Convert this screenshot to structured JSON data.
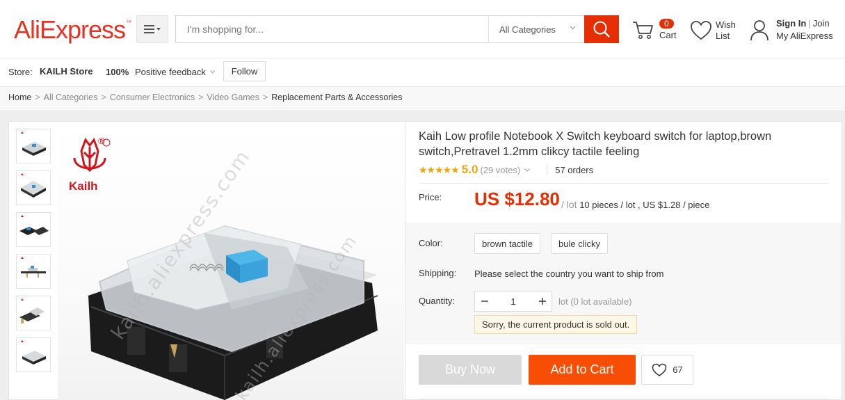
{
  "header": {
    "logo": "AliExpress",
    "logo_tm": "™",
    "search_placeholder": "I'm shopping for...",
    "category": "All Categories",
    "cart_count": "0",
    "cart_label": "Cart",
    "wish_label": "Wish List",
    "sign_in": "Sign In",
    "join": "Join",
    "my_account": "My AliExpress"
  },
  "store": {
    "label": "Store:",
    "name": "KAILH Store",
    "positive_pct": "100%",
    "positive_label": "Positive feedback",
    "follow_label": "Follow"
  },
  "breadcrumb": {
    "home": "Home",
    "items": [
      "All Categories",
      "Consumer Electronics",
      "Video Games"
    ],
    "current": "Replacement Parts & Accessories"
  },
  "gallery": {
    "brand_text": "Kailh",
    "registered": "®",
    "watermark": "kailh.aliexpress.com",
    "thumb_count": 6
  },
  "product": {
    "title": "Kaih Low profile Notebook X Switch keyboard switch for laptop,brown switch,Pretravel 1.2mm clikcy tactile feeling",
    "stars": "★★★★★",
    "rating": "5.0",
    "votes": "(29 votes)",
    "orders": "57 orders",
    "price_label": "Price:",
    "price": "US $12.80",
    "price_lot_sep": "/ lot",
    "price_detail": "10 pieces / lot , US $1.28 / piece",
    "color_label": "Color:",
    "colors": [
      "brown tactile",
      "bule clicky"
    ],
    "shipping_label": "Shipping:",
    "shipping_text": "Please select the country you want to ship from",
    "quantity_label": "Quantity:",
    "quantity_value": "1",
    "quantity_avail": "lot (0 lot available)",
    "sold_out": "Sorry, the current product is sold out.",
    "buy_now": "Buy Now",
    "add_to_cart": "Add to Cart",
    "wish_count": "67"
  },
  "colors": {
    "brand": "#e62e04",
    "rating": "#f0a60c",
    "add_to_cart": "#f74d04"
  }
}
